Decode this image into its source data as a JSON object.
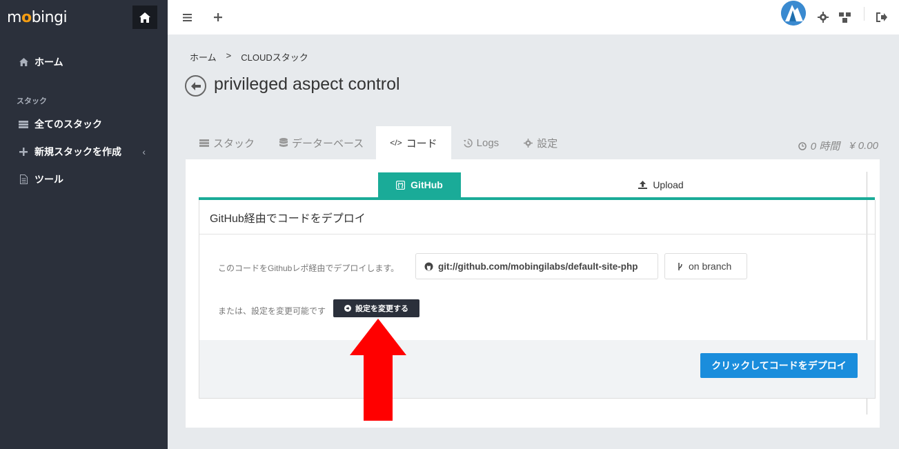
{
  "sidebar": {
    "logo_prefix": "m",
    "logo_accent": "o",
    "logo_rest": "bingi",
    "items": [
      {
        "label": "ホーム",
        "icon": "home-icon"
      },
      {
        "label": "全てのスタック",
        "icon": "list-icon"
      },
      {
        "label": "新規スタックを作成",
        "icon": "plus-icon"
      },
      {
        "label": "ツール",
        "icon": "document-icon"
      }
    ],
    "section_label": "スタック"
  },
  "topbar": {
    "icons": [
      "menu-icon",
      "plus-icon",
      "avatar",
      "gear-icon",
      "cubes-icon",
      "logout-icon"
    ]
  },
  "breadcrumb": {
    "home": "ホーム",
    "separator": ">",
    "current": "CLOUDスタック"
  },
  "page": {
    "title": "privileged aspect control"
  },
  "tabs": [
    {
      "label": "スタック",
      "icon": "server-icon"
    },
    {
      "label": "データーベース",
      "icon": "database-icon"
    },
    {
      "label": "コード",
      "icon": "code-icon",
      "active": true
    },
    {
      "label": "Logs",
      "icon": "history-icon"
    },
    {
      "label": "設定",
      "icon": "gear-icon"
    }
  ],
  "usage": {
    "hours": "0 時間",
    "cost": "¥ 0.00"
  },
  "subtabs": {
    "github": "GitHub",
    "upload": "Upload"
  },
  "card": {
    "heading": "GitHub経由でコードをデプロイ",
    "deploy_text": "このコードをGithubレポ経由でデプロイします。",
    "repo": "git://github.com/mobingilabs/default-site-php",
    "branch": "on branch",
    "alt_text": "または、設定を変更可能です",
    "change_button": "設定を変更する",
    "deploy_button": "クリックしてコードをデプロイ"
  },
  "colors": {
    "sidebar_bg": "#2b303b",
    "accent_teal": "#1aab98",
    "primary_blue": "#1a8ddc",
    "logo_orange": "#f39c12",
    "annotation_red": "#ff0000"
  }
}
